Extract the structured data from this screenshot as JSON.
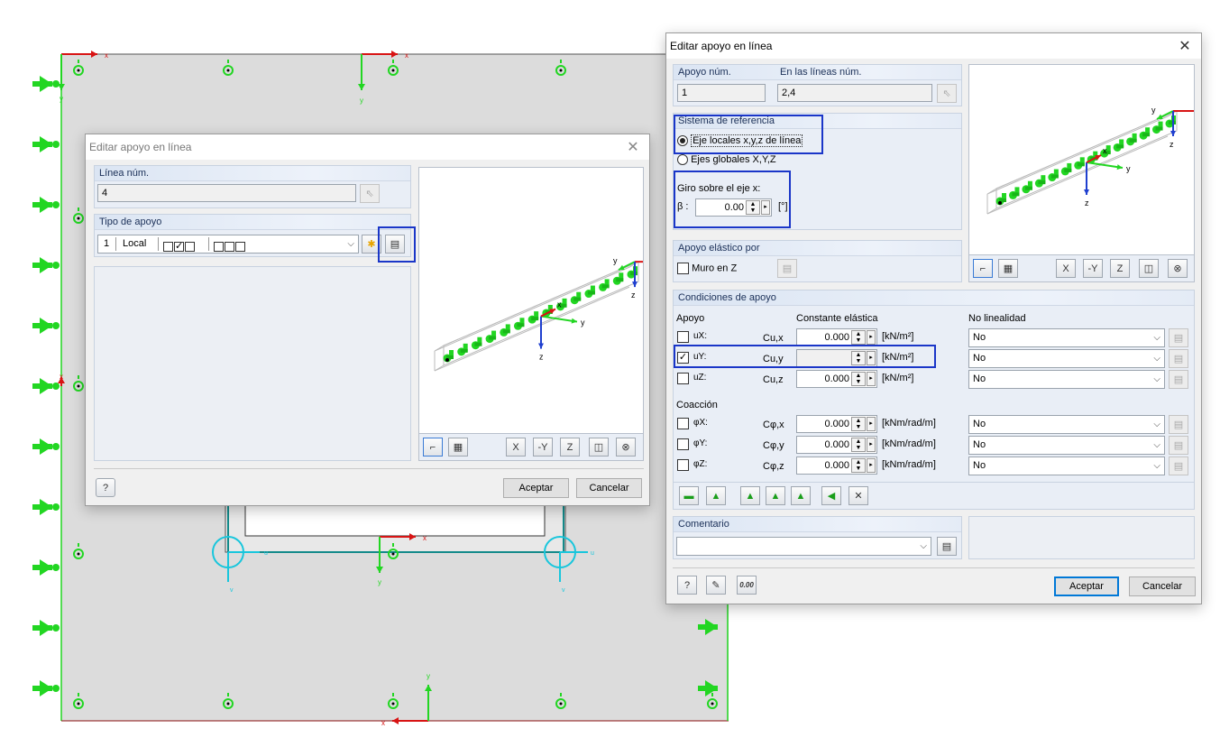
{
  "colors": {
    "accent": "#1a36c8",
    "support_green": "#22d622",
    "axis_red": "#d81414",
    "axis_blue": "#1f3fcf",
    "teal": "#138a8a",
    "cyan": "#18c6dc"
  },
  "background": {
    "axis_labels": {
      "x": "x",
      "y": "y",
      "u": "u",
      "v": "v"
    }
  },
  "dialog_left": {
    "title": "Editar apoyo en línea",
    "line_no_label": "Línea núm.",
    "line_no_value": "4",
    "support_type_label": "Tipo de apoyo",
    "support_type_no": "1",
    "support_type_name": "Local",
    "ok_label": "Aceptar",
    "cancel_label": "Cancelar",
    "preview_axes": {
      "y": "y",
      "z": "z",
      "x": "x",
      "y2": "y",
      "z2": "z"
    }
  },
  "dialog_right": {
    "title": "Editar apoyo en línea",
    "support_no_label": "Apoyo núm.",
    "support_no_value": "1",
    "on_lines_label": "En las líneas núm.",
    "on_lines_value": "2,4",
    "ref_system_label": "Sistema de referencia",
    "ref_local_label": "Eje locales x,y,z  de línea",
    "ref_global_label": "Ejes globales X,Y,Z",
    "rotation_label": "Giro sobre el eje x:",
    "beta_label": "β :",
    "beta_value": "0.00",
    "beta_unit": "[°]",
    "elastic_label": "Apoyo elástico por",
    "wall_label": "Muro en Z",
    "conditions_label": "Condiciones de apoyo",
    "col_support": "Apoyo",
    "col_constant": "Constante elástica",
    "col_nonlinear": "No linealidad",
    "rows": [
      {
        "name": "ux",
        "label": "uX:",
        "const": "Cu,x",
        "value": "0.000",
        "unit": "[kN/m²]",
        "nonlinear": "No",
        "checked": false
      },
      {
        "name": "uy",
        "label": "uY:",
        "const": "Cu,y",
        "value": "",
        "unit": "[kN/m²]",
        "nonlinear": "No",
        "checked": true
      },
      {
        "name": "uz",
        "label": "uZ:",
        "const": "Cu,z",
        "value": "0.000",
        "unit": "[kN/m²]",
        "nonlinear": "No",
        "checked": false
      }
    ],
    "coaction_label": "Coacción",
    "rot_rows": [
      {
        "name": "phix",
        "label": "φX:",
        "const": "Cφ,x",
        "value": "0.000",
        "unit": "[kNm/rad/m]",
        "nonlinear": "No",
        "checked": false
      },
      {
        "name": "phiy",
        "label": "φY:",
        "const": "Cφ,y",
        "value": "0.000",
        "unit": "[kNm/rad/m]",
        "nonlinear": "No",
        "checked": false
      },
      {
        "name": "phiz",
        "label": "φZ:",
        "const": "Cφ,z",
        "value": "0.000",
        "unit": "[kNm/rad/m]",
        "nonlinear": "No",
        "checked": false
      }
    ],
    "comment_label": "Comentario",
    "ok_label": "Aceptar",
    "cancel_label": "Cancelar",
    "preview_axes": {
      "y": "y",
      "z": "z",
      "x": "x",
      "y2": "y",
      "z2": "z"
    },
    "units_button_label": "0.00",
    "view_buttons": [
      "X",
      "-Y",
      "Z"
    ]
  }
}
